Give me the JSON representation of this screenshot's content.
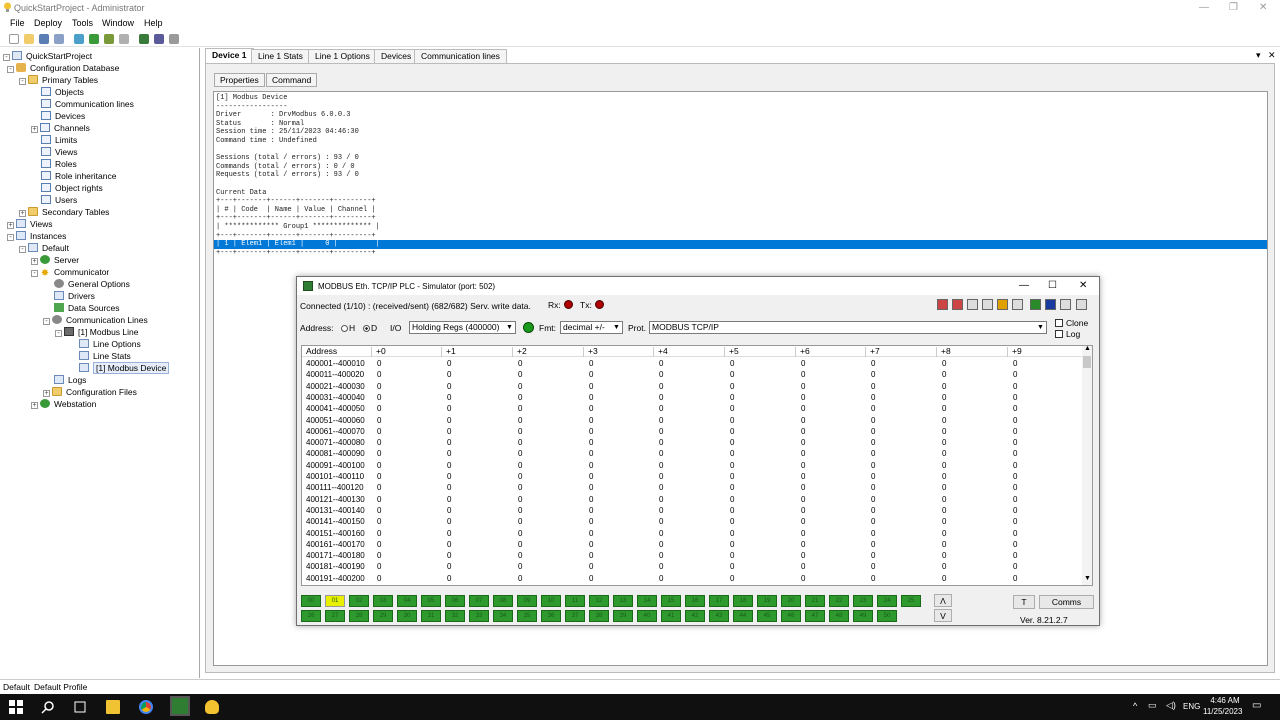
{
  "window": {
    "title": "QuickStartProject - Administrator"
  },
  "menu": [
    "File",
    "Deploy",
    "Tools",
    "Window",
    "Help"
  ],
  "tree": [
    {
      "label": "QuickStartProject",
      "icon": "project-icon"
    },
    {
      "label": "Configuration Database",
      "icon": "database-icon"
    },
    {
      "label": "Primary Tables",
      "icon": "folder-icon"
    },
    {
      "label": "Objects",
      "icon": "table-icon"
    },
    {
      "label": "Communication lines",
      "icon": "table-icon"
    },
    {
      "label": "Devices",
      "icon": "table-icon"
    },
    {
      "label": "Channels",
      "icon": "table-icon"
    },
    {
      "label": "Limits",
      "icon": "table-icon"
    },
    {
      "label": "Views",
      "icon": "table-icon"
    },
    {
      "label": "Roles",
      "icon": "table-icon"
    },
    {
      "label": "Role inheritance",
      "icon": "table-icon"
    },
    {
      "label": "Object rights",
      "icon": "table-icon"
    },
    {
      "label": "Users",
      "icon": "table-icon"
    },
    {
      "label": "Secondary Tables",
      "icon": "folder-icon"
    },
    {
      "label": "Views",
      "icon": "page-icon"
    },
    {
      "label": "Instances",
      "icon": "page-icon"
    },
    {
      "label": "Default",
      "icon": "page-icon"
    },
    {
      "label": "Server",
      "icon": "globe-icon"
    },
    {
      "label": "Communicator",
      "icon": "star-icon"
    },
    {
      "label": "General Options",
      "icon": "gear-icon"
    },
    {
      "label": "Drivers",
      "icon": "page-icon"
    },
    {
      "label": "Data Sources",
      "icon": "green-icon"
    },
    {
      "label": "Communication Lines",
      "icon": "gear-icon"
    },
    {
      "label": "[1] Modbus Line",
      "icon": "line-icon"
    },
    {
      "label": "Line Options",
      "icon": "page-icon"
    },
    {
      "label": "Line Stats",
      "icon": "page-icon"
    },
    {
      "label": "[1] Modbus Device",
      "icon": "page-icon"
    },
    {
      "label": "Logs",
      "icon": "page-icon"
    },
    {
      "label": "Configuration Files",
      "icon": "folder-icon"
    },
    {
      "label": "Webstation",
      "icon": "globe-icon"
    }
  ],
  "tabs": [
    "Device 1",
    "Line 1 Stats",
    "Line 1 Options",
    "Devices",
    "Communication lines"
  ],
  "subtabs": [
    "Properties",
    "Command"
  ],
  "console": {
    "lines": [
      "[1] Modbus Device",
      "-----------------",
      "Driver       : DrvModbus 6.0.0.3",
      "Status       : Normal",
      "Session time : 25/11/2023 04:46:30",
      "Command time : Undefined",
      "",
      "Sessions (total / errors) : 93 / 0",
      "Commands (total / errors) : 0 / 0",
      "Requests (total / errors) : 93 / 0",
      "",
      "Current Data",
      "+---+-------+------+-------+---------+",
      "| # | Code  | Name | Value | Channel |",
      "+---+-------+------+-------+---------+",
      "| ************* Group1 ************** |",
      "+---+-------+------+-------+---------+"
    ],
    "selected_row": "| 1 | Elem1 | Elem1 |     0 |         |",
    "last_line": "+---+-------+------+-------+---------+"
  },
  "simulator": {
    "title": "MODBUS Eth. TCP/IP PLC - Simulator (port: 502)",
    "status": "Connected (1/10) : (received/sent) (682/682) Serv. write data.",
    "rx_label": "Rx:",
    "tx_label": "Tx:",
    "address_label": "Address:",
    "h_label": "H",
    "d_label": "D",
    "io_label": "I/O",
    "io_value": "Holding Regs (400000)",
    "fmt_label": "Fmt:",
    "fmt_value": "decimal +/-",
    "prot_label": "Prot.",
    "prot_value": "MODBUS TCP/IP",
    "clone_label": "Clone",
    "log_label": "Log",
    "columns": [
      "Address",
      "+0",
      "+1",
      "+2",
      "+3",
      "+4",
      "+5",
      "+6",
      "+7",
      "+8",
      "+9"
    ],
    "rows": [
      "400001--400010",
      "400011--400020",
      "400021--400030",
      "400031--400040",
      "400041--400050",
      "400051--400060",
      "400061--400070",
      "400071--400080",
      "400081--400090",
      "400091--400100",
      "400101--400110",
      "400111--400120",
      "400121--400130",
      "400131--400140",
      "400141--400150",
      "400151--400160",
      "400161--400170",
      "400171--400180",
      "400181--400190",
      "400191--400200"
    ],
    "cell_value": "0",
    "row1_buttons": [
      "00",
      "01",
      "02",
      "03",
      "04",
      "05",
      "06",
      "07",
      "08",
      "09",
      "10",
      "11",
      "12",
      "13",
      "14",
      "15",
      "16",
      "17",
      "18",
      "19",
      "20",
      "21",
      "22",
      "23",
      "24",
      "25"
    ],
    "row2_buttons": [
      "26",
      "27",
      "28",
      "29",
      "30",
      "31",
      "32",
      "33",
      "34",
      "35",
      "36",
      "37",
      "38",
      "39",
      "40",
      "41",
      "42",
      "43",
      "44",
      "45",
      "46",
      "47",
      "48",
      "49",
      "50"
    ],
    "up_label": "Λ",
    "down_label": "V",
    "t_label": "T",
    "comms_label": "Comms",
    "version": "Ver. 8.21.2.7"
  },
  "status": {
    "left": "Default",
    "profile": "Default Profile"
  },
  "taskbar": {
    "time": "4:46 AM",
    "date": "11/25/2023",
    "lang": "ENG"
  }
}
